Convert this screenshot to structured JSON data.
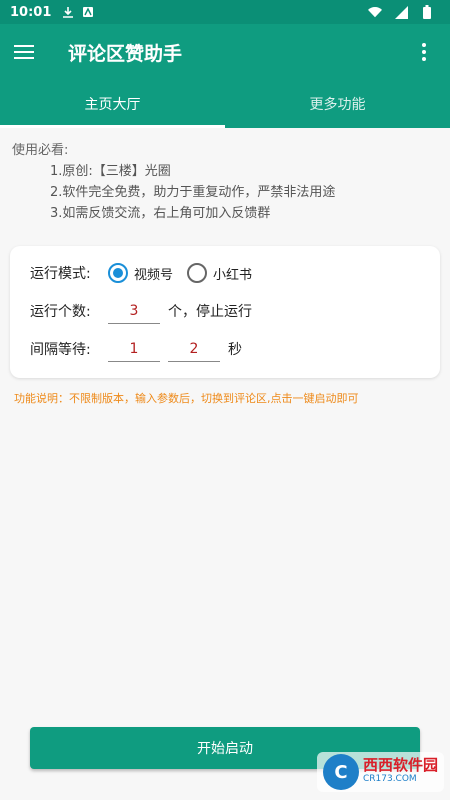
{
  "status_bar": {
    "time": "10:01"
  },
  "app_bar": {
    "title": "评论区赞助手"
  },
  "tabs": [
    {
      "label": "主页大厅",
      "active": true
    },
    {
      "label": "更多功能",
      "active": false
    }
  ],
  "notes": {
    "heading": "使用必看:",
    "items": [
      "1.原创:【三楼】光圈",
      "2.软件完全免费，助力于重复动作，严禁非法用途",
      "3.如需反馈交流，右上角可加入反馈群"
    ]
  },
  "form": {
    "mode_label": "运行模式:",
    "mode_options": [
      {
        "label": "视频号",
        "checked": true
      },
      {
        "label": "小红书",
        "checked": false
      }
    ],
    "count_label": "运行个数:",
    "count_value": "3",
    "count_suffix": "个，停止运行",
    "interval_label": "间隔等待:",
    "interval_min": "1",
    "interval_max": "2",
    "interval_unit": "秒"
  },
  "feature_note": "功能说明：不限制版本，输入参数后，切换到评论区,点击一键启动即可",
  "start_button": "开始启动",
  "watermark": {
    "main": "西西软件园",
    "sub": "CR173.COM"
  },
  "colors": {
    "primary": "#0f9c80",
    "status": "#0b8f76",
    "accent": "#1a8fd8",
    "note": "#ee8a1a"
  }
}
